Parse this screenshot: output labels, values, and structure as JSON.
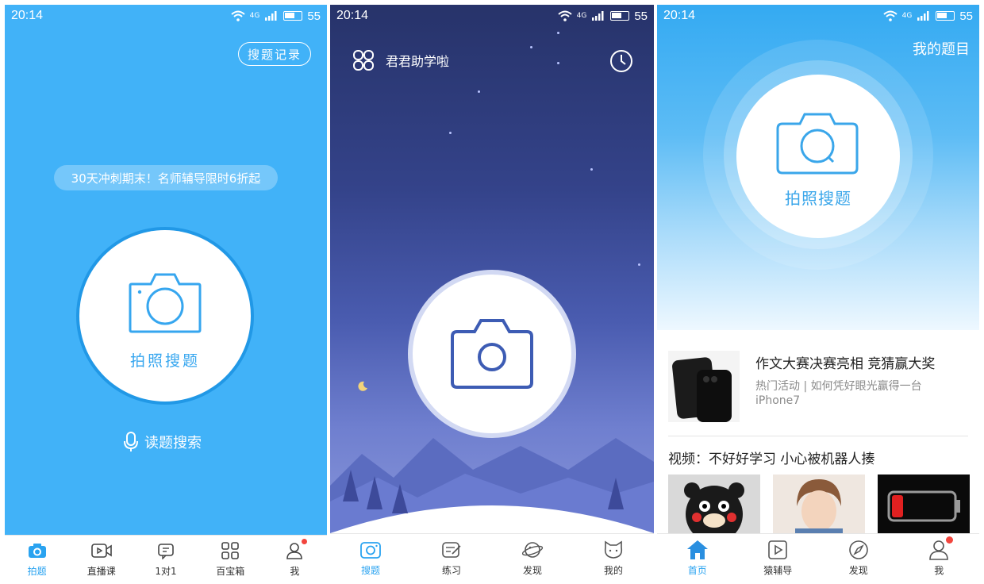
{
  "phone1": {
    "status": {
      "time": "20:14",
      "network": "4G",
      "battery": "55"
    },
    "record_button": "搜题记录",
    "promo": "30天冲刺期末！名师辅导限时6折起",
    "camera_label": "拍照搜题",
    "voice_search": "读题搜索",
    "tabs": [
      {
        "label": "拍题",
        "icon": "camera-icon",
        "active": true
      },
      {
        "label": "直播课",
        "icon": "video-icon",
        "active": false
      },
      {
        "label": "1对1",
        "icon": "tutor-icon",
        "active": false
      },
      {
        "label": "百宝箱",
        "icon": "grid-icon",
        "active": false
      },
      {
        "label": "我",
        "icon": "person-icon",
        "active": false,
        "badge": true
      }
    ],
    "colors": {
      "background": "#41b2f8",
      "accent": "#2aa3f0"
    }
  },
  "phone2": {
    "status": {
      "time": "20:14",
      "network": "4G",
      "battery": "55"
    },
    "brand": "君君助学啦",
    "tabs": [
      {
        "label": "搜题",
        "icon": "camera-icon",
        "active": true
      },
      {
        "label": "练习",
        "icon": "practice-icon",
        "active": false
      },
      {
        "label": "发现",
        "icon": "planet-icon",
        "active": false
      },
      {
        "label": "我的",
        "icon": "cat-icon",
        "active": false
      }
    ],
    "colors": {
      "sky_top": "#27336a",
      "sky_bottom": "#8895d9",
      "camera_stroke": "#3d5cb4"
    }
  },
  "phone3": {
    "status": {
      "time": "20:14",
      "network": "4G",
      "battery": "55"
    },
    "my_questions": "我的题目",
    "camera_label": "拍照搜题",
    "article": {
      "title": "作文大赛决赛亮相 竞猜赢大奖",
      "desc": "热门活动 | 如何凭好眼光赢得一台iPhone7"
    },
    "video_title": "视频：不好好学习 小心被机器人揍",
    "tabs": [
      {
        "label": "首页",
        "icon": "home-icon",
        "active": true
      },
      {
        "label": "猿辅导",
        "icon": "play-icon",
        "active": false
      },
      {
        "label": "发现",
        "icon": "compass-icon",
        "active": false
      },
      {
        "label": "我",
        "icon": "person-icon",
        "active": false,
        "badge": true
      }
    ],
    "colors": {
      "hero": "#34aaf2",
      "accent": "#2a8fe0"
    }
  }
}
